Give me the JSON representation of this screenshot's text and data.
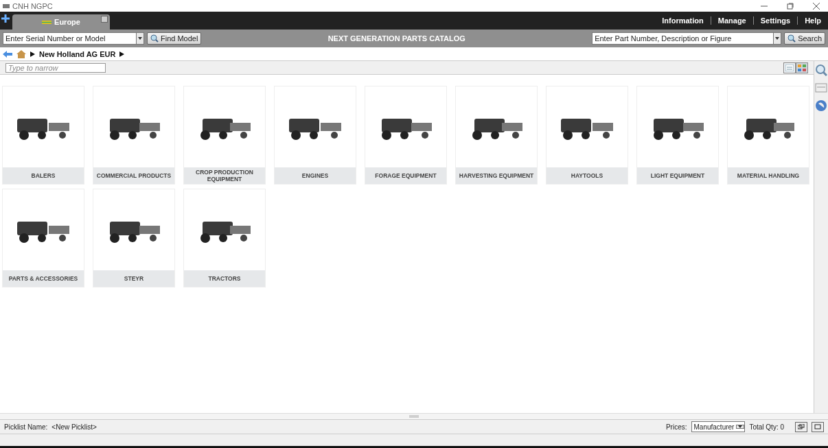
{
  "window": {
    "title": "CNH NGPC"
  },
  "tabs": [
    {
      "label": "Europe",
      "selected": true
    }
  ],
  "menu": [
    "Information",
    "Manage",
    "Settings",
    "Help"
  ],
  "toolbar": {
    "model_search": {
      "placeholder": "Enter Serial Number or Model"
    },
    "find_button": "Find Model",
    "heading": "NEXT GENERATION PARTS CATALOG",
    "part_search": {
      "placeholder": "Enter Part Number, Description or Figure"
    },
    "search_button": "Search"
  },
  "breadcrumb": [
    "New Holland AG EUR"
  ],
  "filter": {
    "placeholder": "Type to narrow"
  },
  "views": [
    {
      "kind": "list",
      "selected": false
    },
    {
      "kind": "grid",
      "selected": true
    }
  ],
  "categories": [
    {
      "label": "BALERS"
    },
    {
      "label": "COMMERCIAL PRODUCTS"
    },
    {
      "label": "CROP PRODUCTION EQUIPMENT"
    },
    {
      "label": "ENGINES"
    },
    {
      "label": "FORAGE EQUIPMENT"
    },
    {
      "label": "HARVESTING EQUIPMENT"
    },
    {
      "label": "HAYTOOLS"
    },
    {
      "label": "LIGHT EQUIPMENT"
    },
    {
      "label": "MATERIAL HANDLING"
    },
    {
      "label": "PARTS & ACCESSORIES"
    },
    {
      "label": "STEYR"
    },
    {
      "label": "TRACTORS"
    }
  ],
  "status_bar": {
    "picklist_label": "Picklist Name:",
    "picklist_value": "<New Picklist>",
    "prices_label": "Prices:",
    "prices_value": "Manufacturer",
    "total_qty": "Total Qty: 0"
  }
}
